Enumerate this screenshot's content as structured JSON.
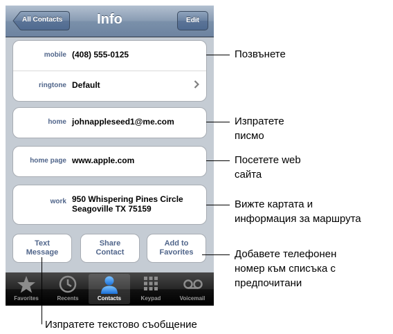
{
  "navbar": {
    "back_label": "All Contacts",
    "title": "Info",
    "edit_label": "Edit"
  },
  "contact": {
    "mobile": {
      "label": "mobile",
      "value": "(408) 555-0125"
    },
    "ringtone": {
      "label": "ringtone",
      "value": "Default"
    },
    "email": {
      "label": "home",
      "value": "johnappleseed1@me.com"
    },
    "homepage": {
      "label": "home page",
      "value": "www.apple.com"
    },
    "address": {
      "label": "work",
      "line1": "950 Whispering Pines Circle",
      "line2": "Seagoville TX 75159"
    }
  },
  "actions": {
    "text_message": [
      "Text",
      "Message"
    ],
    "share_contact": [
      "Share",
      "Contact"
    ],
    "add_favorites": [
      "Add to",
      "Favorites"
    ]
  },
  "tabs": [
    {
      "label": "Favorites",
      "icon": "star-icon"
    },
    {
      "label": "Recents",
      "icon": "clock-icon"
    },
    {
      "label": "Contacts",
      "icon": "person-icon",
      "active": true
    },
    {
      "label": "Keypad",
      "icon": "keypad-icon"
    },
    {
      "label": "Voicemail",
      "icon": "voicemail-icon"
    }
  ],
  "callouts": {
    "call": "Позвънете",
    "email": [
      "Изпратете",
      "писмо"
    ],
    "web": [
      "Посетете web",
      "сайта"
    ],
    "map": [
      "Вижте картата и",
      "информация за маршрута"
    ],
    "favorites": [
      "Добавете телефонен",
      "номер към списъка с",
      "предпочитани"
    ],
    "text": "Изпратете текстово съобщение"
  },
  "colors": {
    "label_blue": "#50658a",
    "nav_blue": "#6d83a0",
    "background": "#c5ccd4"
  }
}
